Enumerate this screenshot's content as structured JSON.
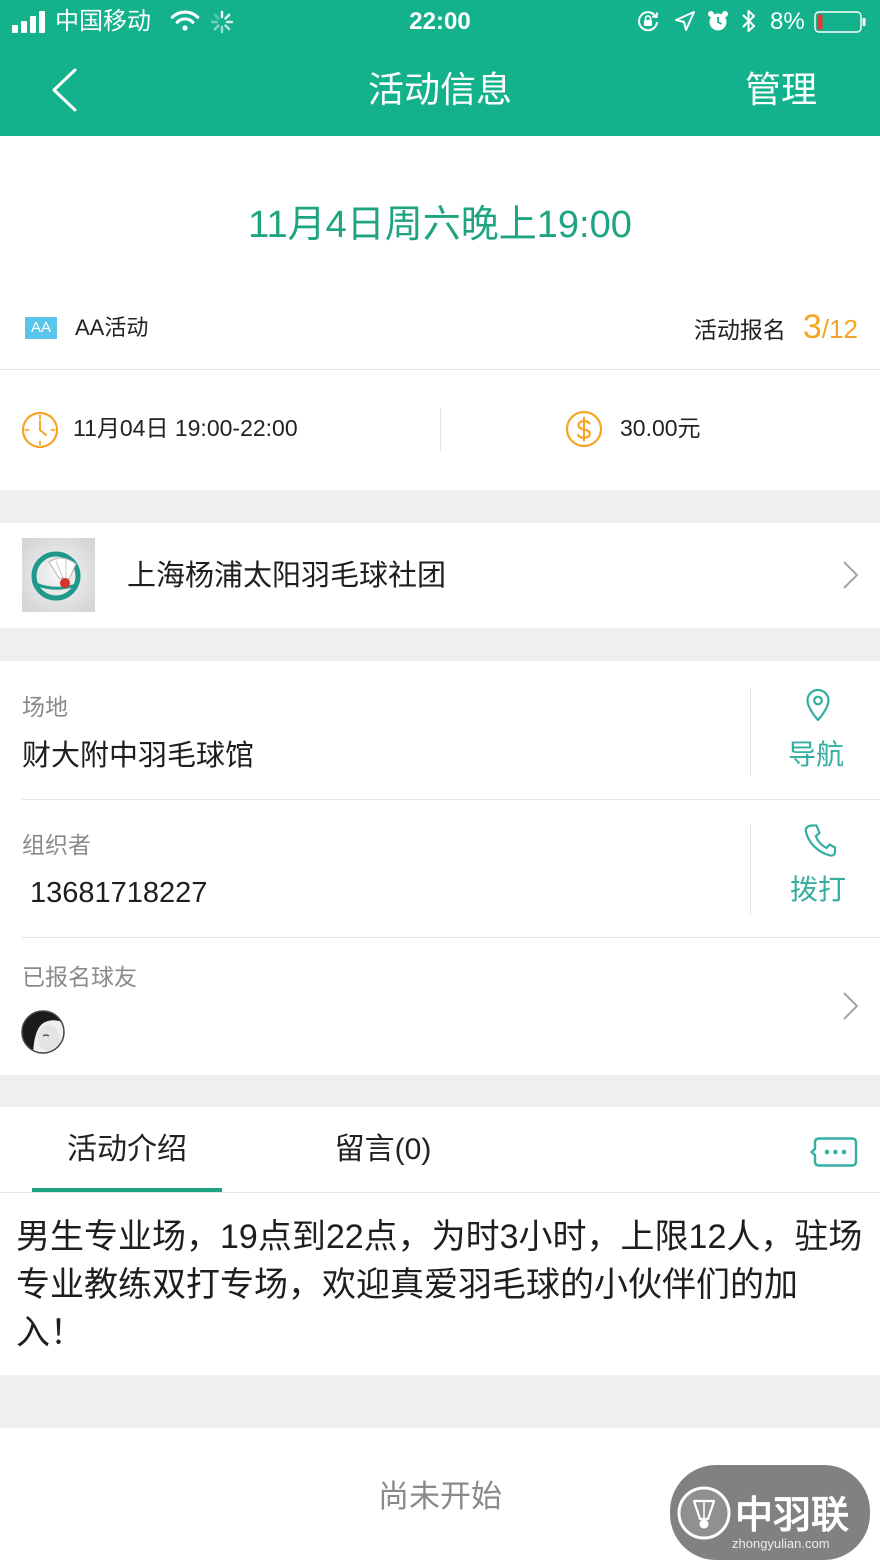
{
  "status_bar": {
    "carrier": "中国移动",
    "time": "22:00",
    "battery_percent": "8%"
  },
  "nav": {
    "title": "活动信息",
    "manage_label": "管理"
  },
  "activity": {
    "datetime_title": "11月4日周六晚上19:00",
    "type_badge": "AA",
    "type_label": "AA活动",
    "signup_label": "活动报名",
    "signup_count": "3",
    "signup_separator": "/",
    "signup_limit": "12",
    "time_range": "11月04日 19:00-22:00",
    "fee": "30.00元"
  },
  "club": {
    "name": "上海杨浦太阳羽毛球社团"
  },
  "venue": {
    "label": "场地",
    "name": "财大附中羽毛球馆",
    "action_label": "导航"
  },
  "organizer": {
    "label": "组织者",
    "phone": "13681718227",
    "action_label": "拨打"
  },
  "participants": {
    "label": "已报名球友"
  },
  "tabs": [
    {
      "label": "活动介绍",
      "active": true
    },
    {
      "label": "留言(0)",
      "active": false
    }
  ],
  "description": "男生专业场，19点到22点，为时3小时，上限12人，驻场专业教练双打专场，欢迎真爱羽毛球的小伙伴们的加入！",
  "footer": {
    "status_label": "尚未开始"
  },
  "watermark": {
    "brand": "中羽联",
    "site": "zhongyulian.com"
  },
  "icons": {
    "back": "chevron-left-icon",
    "time": "clock-icon",
    "fee": "dollar-icon",
    "venue": "map-pin-icon",
    "call": "phone-icon",
    "message": "comment-icon",
    "disclosure": "chevron-right-icon"
  },
  "colors": {
    "header": "#14b28c",
    "date_text": "#1fa482",
    "action_teal": "#35aea2",
    "highlight_orange": "#f4a523",
    "badge_blue": "#5bc4ea",
    "page_background": "#efefef",
    "battery_low": "#e53935"
  }
}
